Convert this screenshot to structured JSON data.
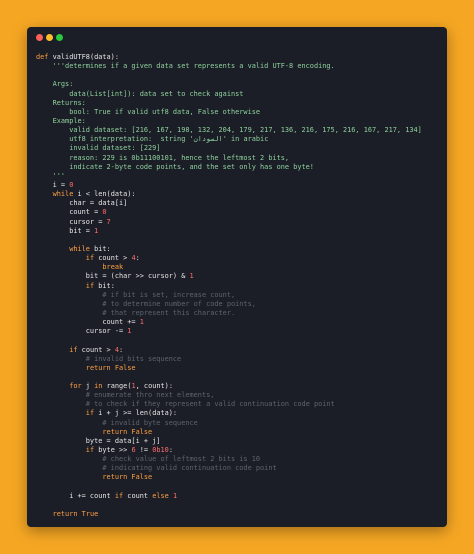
{
  "colors": {
    "background": "#f5a623",
    "editor": "#1b1e26",
    "keyword": "#ff9f43",
    "string": "#8fd19e",
    "number": "#ff6b6b",
    "comment": "#5c6370",
    "text": "#e6e6e6"
  },
  "window_controls": [
    "close-dot",
    "minimize-dot",
    "maximize-dot"
  ],
  "code_lines": [
    [
      [
        "kw",
        "def"
      ],
      [
        "txt",
        " validUTF8(data):"
      ]
    ],
    [
      [
        "str",
        "    '''determines if a given data set represents a valid UTF-8 encoding."
      ]
    ],
    [],
    [
      [
        "str",
        "    Args:"
      ]
    ],
    [
      [
        "str",
        "        data(List[int]): data set to check against"
      ]
    ],
    [
      [
        "str",
        "    Returns:"
      ]
    ],
    [
      [
        "str",
        "        bool: True if valid utf8 data, False otherwise"
      ]
    ],
    [
      [
        "str",
        "    Example:"
      ]
    ],
    [
      [
        "str",
        "        valid dataset: [216, 167, 198, 132, 204, 179, 217, 136, 216, 175, 216, 167, 217, 134]"
      ]
    ],
    [
      [
        "str",
        "        utf8 interpretation:  string 'السودان' in arabic"
      ]
    ],
    [
      [
        "str",
        "        invalid dataset: [229]"
      ]
    ],
    [
      [
        "str",
        "        reason: 229 is 0b11100101, hence the leftmost 2 bits,"
      ]
    ],
    [
      [
        "str",
        "        indicate 2-byte code points, and the set only has one byte!"
      ]
    ],
    [
      [
        "str",
        "    '''"
      ]
    ],
    [
      [
        "txt",
        "    i = "
      ],
      [
        "num",
        "0"
      ]
    ],
    [
      [
        "txt",
        "    "
      ],
      [
        "kw",
        "while"
      ],
      [
        "txt",
        " i < len(data):"
      ]
    ],
    [
      [
        "txt",
        "        char = data[i]"
      ]
    ],
    [
      [
        "txt",
        "        count = "
      ],
      [
        "num",
        "0"
      ]
    ],
    [
      [
        "txt",
        "        cursor = "
      ],
      [
        "num",
        "7"
      ]
    ],
    [
      [
        "txt",
        "        bit = "
      ],
      [
        "num",
        "1"
      ]
    ],
    [],
    [
      [
        "txt",
        "        "
      ],
      [
        "kw",
        "while"
      ],
      [
        "txt",
        " bit:"
      ]
    ],
    [
      [
        "txt",
        "            "
      ],
      [
        "kw",
        "if"
      ],
      [
        "txt",
        " count > "
      ],
      [
        "num",
        "4"
      ],
      [
        "txt",
        ":"
      ]
    ],
    [
      [
        "txt",
        "                "
      ],
      [
        "kw",
        "break"
      ]
    ],
    [
      [
        "txt",
        "            bit = (char >> cursor) & "
      ],
      [
        "num",
        "1"
      ]
    ],
    [
      [
        "txt",
        "            "
      ],
      [
        "kw",
        "if"
      ],
      [
        "txt",
        " bit:"
      ]
    ],
    [
      [
        "cmt",
        "                # if bit is set, increase count,"
      ]
    ],
    [
      [
        "cmt",
        "                # to determine number of code points,"
      ]
    ],
    [
      [
        "cmt",
        "                # that represent this character."
      ]
    ],
    [
      [
        "txt",
        "                count += "
      ],
      [
        "num",
        "1"
      ]
    ],
    [
      [
        "txt",
        "            cursor -= "
      ],
      [
        "num",
        "1"
      ]
    ],
    [],
    [
      [
        "txt",
        "        "
      ],
      [
        "kw",
        "if"
      ],
      [
        "txt",
        " count > "
      ],
      [
        "num",
        "4"
      ],
      [
        "txt",
        ":"
      ]
    ],
    [
      [
        "cmt",
        "            # invalid bits sequence"
      ]
    ],
    [
      [
        "txt",
        "            "
      ],
      [
        "kw",
        "return False"
      ]
    ],
    [],
    [
      [
        "txt",
        "        "
      ],
      [
        "kw",
        "for"
      ],
      [
        "txt",
        " j "
      ],
      [
        "kw",
        "in"
      ],
      [
        "txt",
        " range("
      ],
      [
        "num",
        "1"
      ],
      [
        "txt",
        ", count):"
      ]
    ],
    [
      [
        "cmt",
        "            # enumerate thro next elements,"
      ]
    ],
    [
      [
        "cmt",
        "            # to check if they represent a valid continuation code point"
      ]
    ],
    [
      [
        "txt",
        "            "
      ],
      [
        "kw",
        "if"
      ],
      [
        "txt",
        " i + j >= len(data):"
      ]
    ],
    [
      [
        "cmt",
        "                # invalid byte sequence"
      ]
    ],
    [
      [
        "txt",
        "                "
      ],
      [
        "kw",
        "return False"
      ]
    ],
    [
      [
        "txt",
        "            byte = data[i + j]"
      ]
    ],
    [
      [
        "txt",
        "            "
      ],
      [
        "kw",
        "if"
      ],
      [
        "txt",
        " byte >> "
      ],
      [
        "num",
        "6"
      ],
      [
        "txt",
        " != "
      ],
      [
        "num",
        "0b10"
      ],
      [
        "txt",
        ":"
      ]
    ],
    [
      [
        "cmt",
        "                # check value of leftmost 2 bits is 10"
      ]
    ],
    [
      [
        "cmt",
        "                # indicating valid continuation code point"
      ]
    ],
    [
      [
        "txt",
        "                "
      ],
      [
        "kw",
        "return False"
      ]
    ],
    [],
    [
      [
        "txt",
        "        i += count "
      ],
      [
        "kw",
        "if"
      ],
      [
        "txt",
        " count "
      ],
      [
        "kw",
        "else"
      ],
      [
        "txt",
        " "
      ],
      [
        "num",
        "1"
      ]
    ],
    [],
    [
      [
        "txt",
        "    "
      ],
      [
        "kw",
        "return True"
      ]
    ]
  ]
}
